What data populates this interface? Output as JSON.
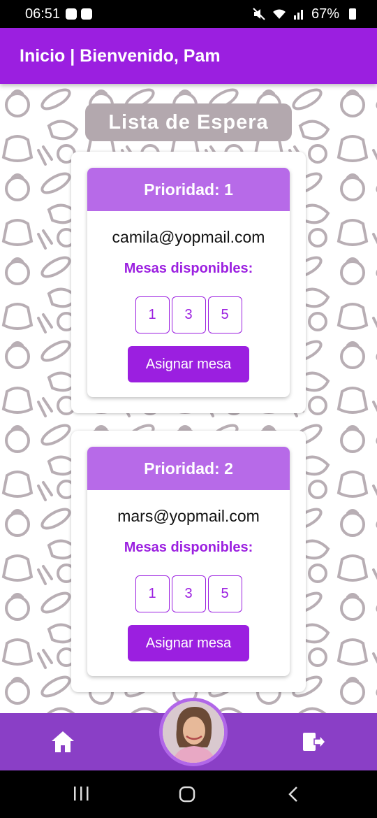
{
  "status_bar": {
    "time": "06:51",
    "battery": "67%"
  },
  "header": {
    "title": "Inicio | Bienvenido, Pam"
  },
  "page": {
    "title": "Lista de Espera"
  },
  "cards": [
    {
      "priority": "Prioridad: 1",
      "email": "camila@yopmail.com",
      "mesas_label": "Mesas disponibles:",
      "mesas": [
        "1",
        "3",
        "5"
      ],
      "button": "Asignar mesa"
    },
    {
      "priority": "Prioridad: 2",
      "email": "mars@yopmail.com",
      "mesas_label": "Mesas disponibles:",
      "mesas": [
        "1",
        "3",
        "5"
      ],
      "button": "Asignar mesa"
    }
  ],
  "bottom_nav": {
    "home_icon": "home-icon",
    "logout_icon": "logout-icon",
    "avatar": "profile-avatar"
  },
  "colors": {
    "primary": "#9b1fe0",
    "card_header": "#b76ae8",
    "nav": "#8a3fc6",
    "title_pill": "#b3a8ae"
  }
}
